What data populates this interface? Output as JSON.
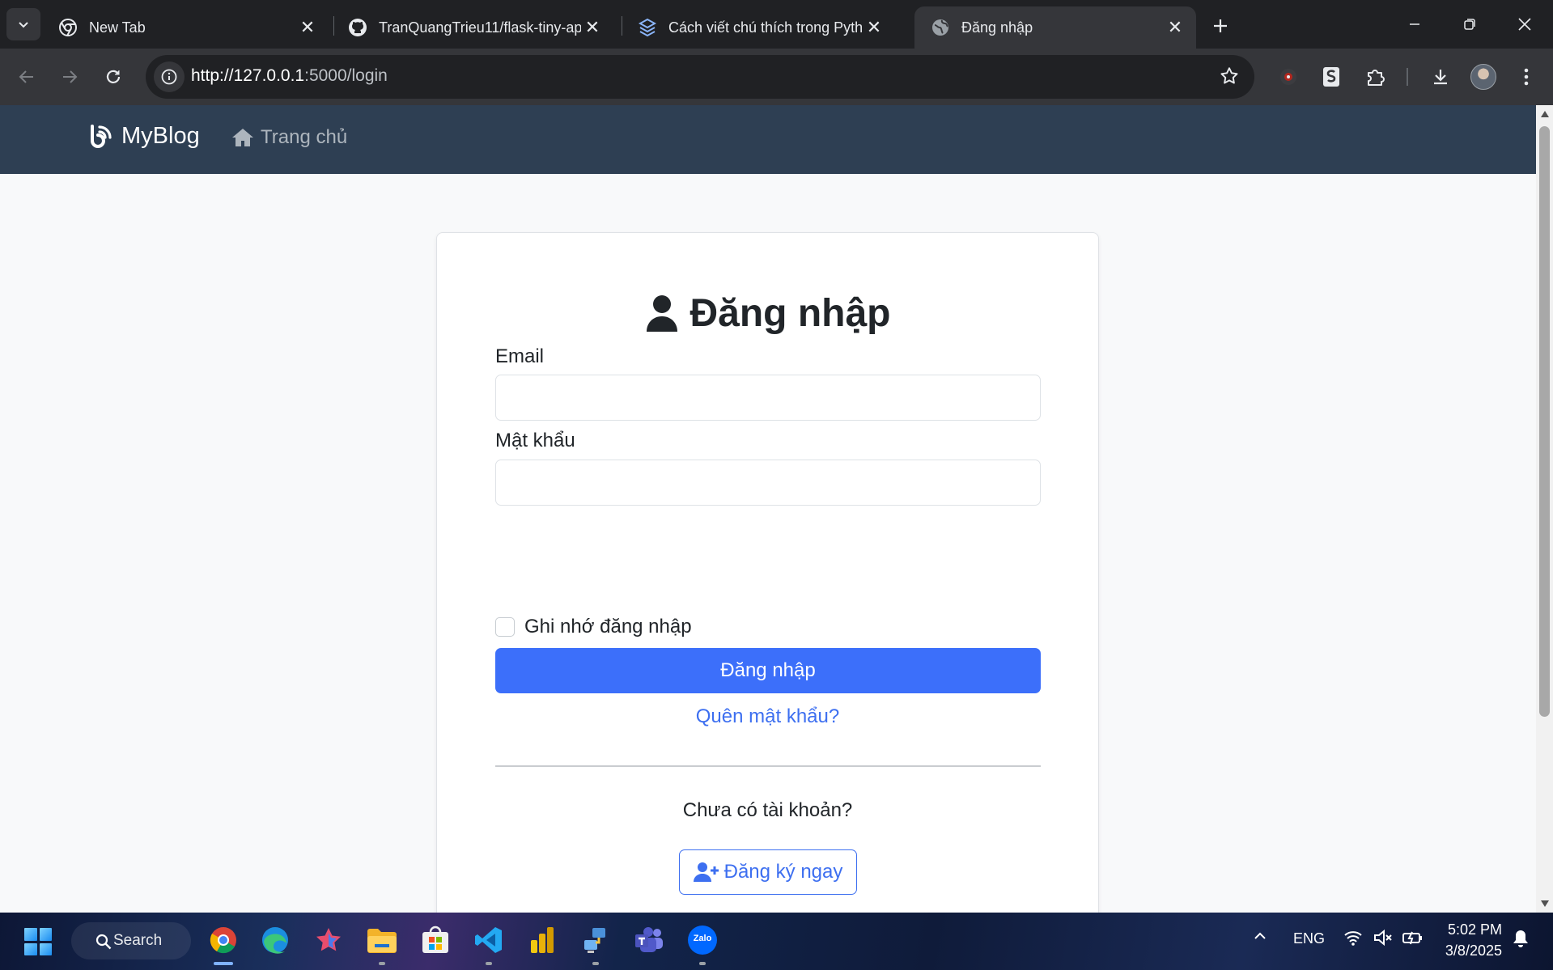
{
  "browser": {
    "tabs": [
      {
        "title": "New Tab",
        "icon": "chrome-icon",
        "active": false
      },
      {
        "title": "TranQuangTrieu11/flask-tiny-ap",
        "icon": "github-icon",
        "active": false
      },
      {
        "title": "Cách viết chú thích trong Pytho",
        "icon": "stack-icon",
        "active": false
      },
      {
        "title": "Đăng nhập",
        "icon": "globe-icon",
        "active": true
      }
    ],
    "url_host": "http://127.0.0.1",
    "url_path": ":5000/login"
  },
  "page": {
    "navbar": {
      "brand": "MyBlog",
      "home_link": "Trang chủ"
    },
    "login": {
      "title": "Đăng nhập",
      "email_label": "Email",
      "email_value": "",
      "password_label": "Mật khẩu",
      "password_value": "",
      "remember_label": "Ghi nhớ đăng nhập",
      "remember_checked": false,
      "submit_label": "Đăng nhập",
      "forgot_link": "Quên mật khẩu?",
      "no_account_text": "Chưa có tài khoản?",
      "register_label": "Đăng ký ngay"
    },
    "colors": {
      "navbar": "#2e3f53",
      "primary": "#3c6ffa",
      "background": "#f8f9fa"
    }
  },
  "taskbar": {
    "search_label": "Search",
    "apps": [
      "chrome",
      "edge",
      "app-star",
      "file-explorer",
      "microsoft-store",
      "vscode",
      "power-bi",
      "network-tool",
      "teams",
      "zalo"
    ],
    "zalo_label": "Zalo",
    "language": "ENG",
    "time": "5:02 PM",
    "date": "3/8/2025"
  }
}
